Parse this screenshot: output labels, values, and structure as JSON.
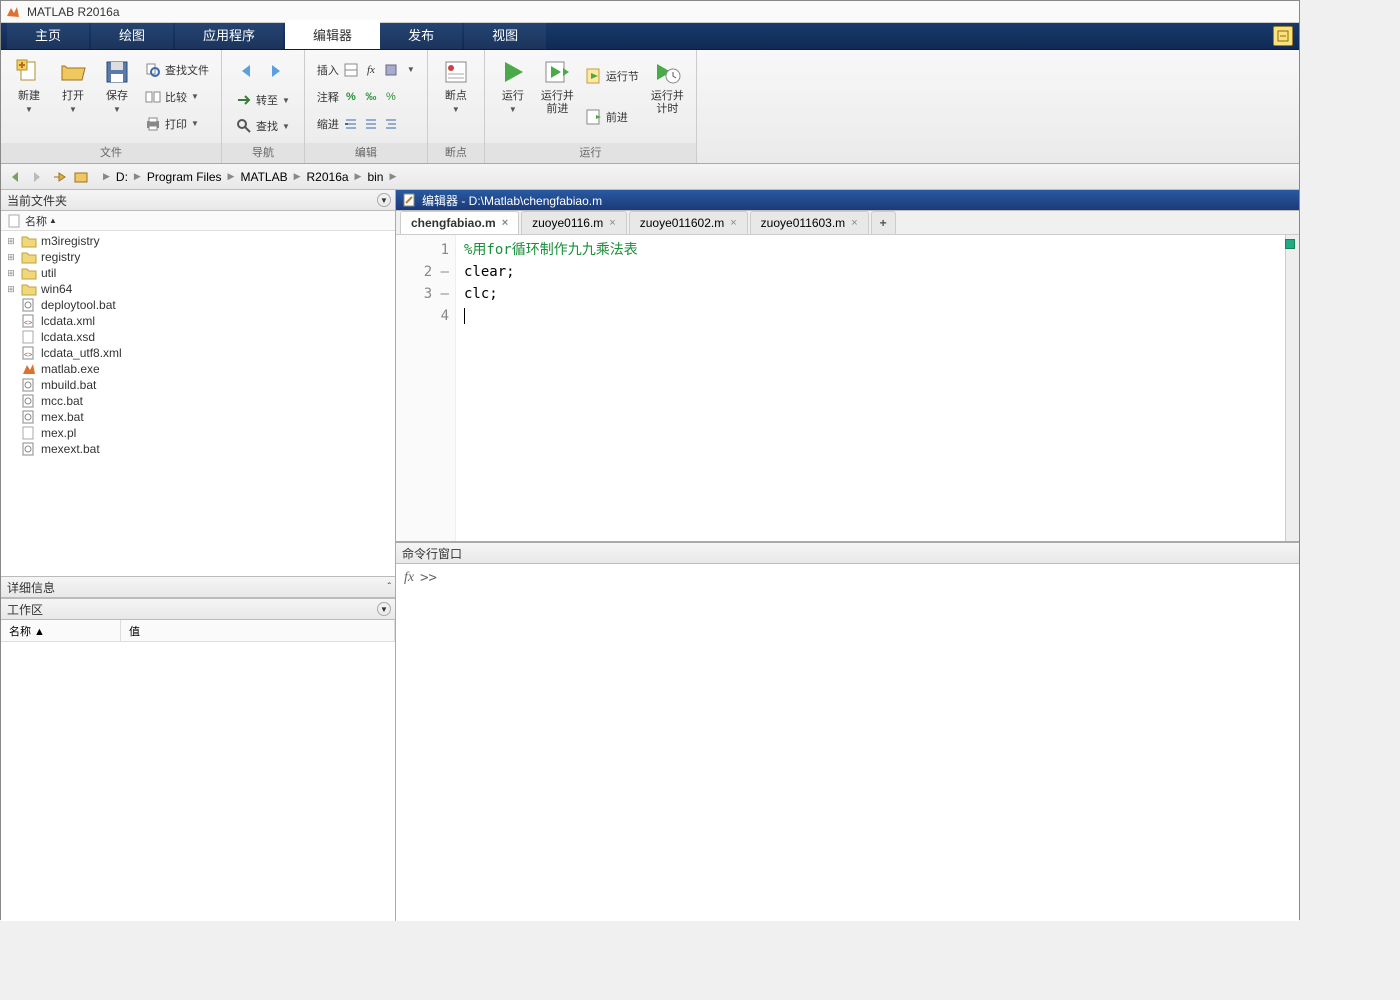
{
  "titlebar": {
    "title": "MATLAB R2016a"
  },
  "mainTabs": {
    "items": [
      {
        "label": "主页"
      },
      {
        "label": "绘图"
      },
      {
        "label": "应用程序"
      },
      {
        "label": "编辑器"
      },
      {
        "label": "发布"
      },
      {
        "label": "视图"
      }
    ],
    "activeIndex": 3
  },
  "toolstrip": {
    "groups": {
      "file": {
        "label": "文件",
        "new_": "新建",
        "open": "打开",
        "save": "保存",
        "findFiles": "查找文件",
        "compare": "比较",
        "print": "打印"
      },
      "nav": {
        "label": "导航",
        "goto": "转至",
        "find": "查找"
      },
      "edit": {
        "label": "编辑",
        "insert": "插入",
        "comment": "注释",
        "indent": "缩进",
        "fx": "fx"
      },
      "bp": {
        "label": "断点",
        "breakpoints": "断点"
      },
      "run": {
        "label": "运行",
        "run": "运行",
        "runAdvance": "运行并\n前进",
        "runSection": "运行节",
        "advance": "前进",
        "runTime": "运行并\n计时"
      }
    }
  },
  "address": {
    "segments": [
      "D:",
      "Program Files",
      "MATLAB",
      "R2016a",
      "bin"
    ]
  },
  "currentFolder": {
    "title": "当前文件夹",
    "colName": "名称",
    "items": [
      {
        "name": "m3iregistry",
        "type": "folder",
        "expandable": true
      },
      {
        "name": "registry",
        "type": "folder",
        "expandable": true
      },
      {
        "name": "util",
        "type": "folder",
        "expandable": true
      },
      {
        "name": "win64",
        "type": "folder",
        "expandable": true
      },
      {
        "name": "deploytool.bat",
        "type": "bat"
      },
      {
        "name": "lcdata.xml",
        "type": "xml"
      },
      {
        "name": "lcdata.xsd",
        "type": "file"
      },
      {
        "name": "lcdata_utf8.xml",
        "type": "xml"
      },
      {
        "name": "matlab.exe",
        "type": "exe"
      },
      {
        "name": "mbuild.bat",
        "type": "bat"
      },
      {
        "name": "mcc.bat",
        "type": "bat"
      },
      {
        "name": "mex.bat",
        "type": "bat"
      },
      {
        "name": "mex.pl",
        "type": "file"
      },
      {
        "name": "mexext.bat",
        "type": "bat"
      }
    ]
  },
  "details": {
    "title": "详细信息"
  },
  "workspace": {
    "title": "工作区",
    "cols": {
      "name": "名称 ▲",
      "value": "值"
    }
  },
  "editor": {
    "title": "编辑器 - D:\\Matlab\\chengfabiao.m",
    "tabs": [
      {
        "label": "chengfabiao.m",
        "active": true
      },
      {
        "label": "zuoye0116.m"
      },
      {
        "label": "zuoye011602.m"
      },
      {
        "label": "zuoye011603.m"
      }
    ],
    "lines": [
      {
        "n": "1",
        "dash": "",
        "text": "%用for循环制作九九乘法表",
        "cls": "comment"
      },
      {
        "n": "2",
        "dash": "—",
        "text": "clear;"
      },
      {
        "n": "3",
        "dash": "—",
        "text": "clc;"
      },
      {
        "n": "4",
        "dash": "",
        "text": "",
        "cursor": true
      }
    ]
  },
  "command": {
    "title": "命令行窗口",
    "fx": "fx",
    "prompt": ">>"
  }
}
